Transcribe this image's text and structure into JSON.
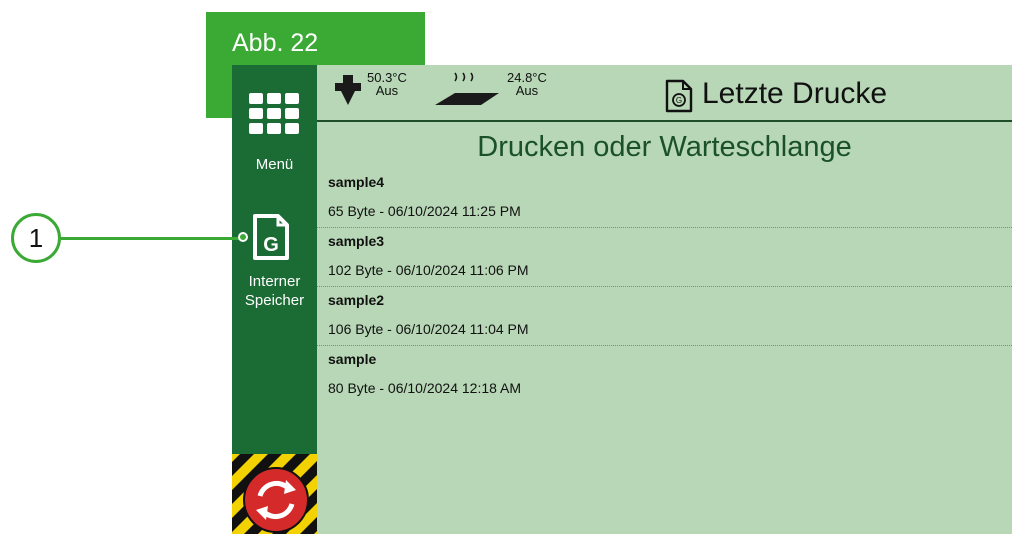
{
  "figure_label": "Abb. 22",
  "callout": "1",
  "sidebar": {
    "menu_label": "Menü",
    "storage_label_line1": "Interner",
    "storage_label_line2": "Speicher",
    "storage_icon_letter": "G"
  },
  "status": {
    "nozzle_temp": "50.3°C",
    "nozzle_state": "Aus",
    "bed_temp": "24.8°C",
    "bed_state": "Aus"
  },
  "header": {
    "title": "Letzte Drucke",
    "subtitle": "Drucken oder Warteschlange"
  },
  "files": [
    {
      "name": "sample4",
      "meta": "65 Byte - 06/10/2024 11:25 PM"
    },
    {
      "name": "sample3",
      "meta": "102 Byte - 06/10/2024 11:06 PM"
    },
    {
      "name": "sample2",
      "meta": "106 Byte - 06/10/2024 11:04 PM"
    },
    {
      "name": "sample",
      "meta": "80 Byte - 06/10/2024 12:18 AM"
    }
  ],
  "colors": {
    "accent": "#3aaa35",
    "sidebar": "#1b6b34",
    "screen_bg": "#b7d7b6"
  }
}
